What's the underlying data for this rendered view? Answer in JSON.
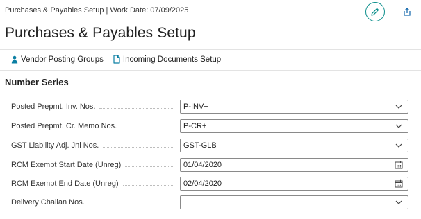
{
  "window": {
    "title": "Purchases & Payables Setup | Work Date: 07/09/2025"
  },
  "header": {
    "edit_icon": "pencil-icon",
    "share_icon": "share-icon"
  },
  "page": {
    "title": "Purchases & Payables Setup"
  },
  "actions": [
    {
      "label": "Vendor Posting Groups",
      "icon": "person-icon"
    },
    {
      "label": "Incoming Documents Setup",
      "icon": "document-icon"
    }
  ],
  "section": {
    "title": "Number Series"
  },
  "fields": [
    {
      "label": "Posted Prepmt. Inv. Nos.",
      "value": "P-INV+",
      "control": "dropdown"
    },
    {
      "label": "Posted Prepmt. Cr. Memo Nos.",
      "value": "P-CR+",
      "control": "dropdown"
    },
    {
      "label": "GST Liability Adj. Jnl Nos.",
      "value": "GST-GLB",
      "control": "dropdown"
    },
    {
      "label": "RCM Exempt Start Date (Unreg)",
      "value": "01/04/2020",
      "control": "date"
    },
    {
      "label": "RCM Exempt End Date (Unreg)",
      "value": "02/04/2020",
      "control": "date"
    },
    {
      "label": "Delivery Challan Nos.",
      "value": "",
      "control": "dropdown"
    }
  ],
  "colors": {
    "accent": "#0b8f8c",
    "border": "#8a8a8a"
  }
}
